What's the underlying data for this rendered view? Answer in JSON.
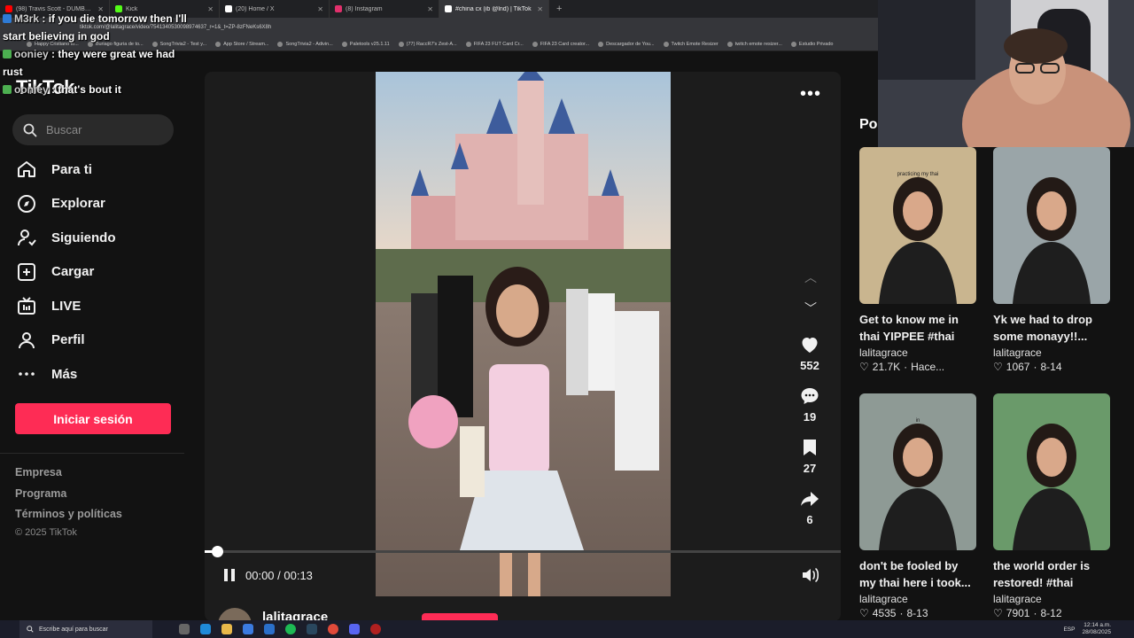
{
  "browser": {
    "tabs": [
      {
        "label": "(98) Travis Scott - DUMBO (Offi",
        "color": "#ff0000",
        "active": false
      },
      {
        "label": "Kick",
        "color": "#53fc18",
        "active": false
      },
      {
        "label": "(20) Home / X",
        "color": "#ffffff",
        "active": false
      },
      {
        "label": "(8) Instagram",
        "color": "#e1306c",
        "active": false
      },
      {
        "label": "#china cx (ib @lnd) | TikTok",
        "color": "#ffffff",
        "active": true
      }
    ],
    "url": "tiktok.com/@lalitagrace/video/7541340530098974637_r=1&_t=ZP-8zFNeKs6X8h",
    "bookmarks": [
      "Happy Cristiano fo...",
      "Buriago figuria de to...",
      "SongTrivia2 - Test y...",
      "App Store / Stream...",
      "SongTrivia2 - Adivin...",
      "Paletools v25.1.11",
      "(77) RaccR7's Zest-A...",
      "FIFA 23 FUT Card Cr...",
      "FIFA 23 Card creator...",
      "Descargador de You...",
      "Twitch Emote Resizer",
      "twitch emote resizer...",
      "Estudio Privado"
    ]
  },
  "chat": [
    {
      "name": "M3rk",
      "message": "if you die tomorrow then I'll start believing in god",
      "color": "#2e7bd6"
    },
    {
      "name": "ooniey",
      "message": "they were great we had rust",
      "color": "#4caf50"
    },
    {
      "name": "ooniey",
      "message": "that's bout it",
      "color": "#4caf50"
    }
  ],
  "sidebar": {
    "logo": "TikTok",
    "search_placeholder": "Buscar",
    "nav": [
      {
        "label": "Para ti",
        "icon": "home-icon"
      },
      {
        "label": "Explorar",
        "icon": "compass-icon"
      },
      {
        "label": "Siguiendo",
        "icon": "following-icon"
      },
      {
        "label": "Cargar",
        "icon": "upload-icon"
      },
      {
        "label": "LIVE",
        "icon": "live-icon"
      },
      {
        "label": "Perfil",
        "icon": "profile-icon"
      },
      {
        "label": "Más",
        "icon": "more-icon"
      }
    ],
    "login_label": "Iniciar sesión",
    "footer_links": [
      "Empresa",
      "Programa",
      "Términos y políticas"
    ],
    "copyright": "© 2025 TikTok"
  },
  "player": {
    "likes": "552",
    "comments": "19",
    "saves": "27",
    "shares": "6",
    "time": "00:00 / 00:13",
    "progress_fraction": 0.02,
    "author": "lalitagrace"
  },
  "related": {
    "title": "Po",
    "cards": [
      {
        "title": "Get to know me in thai YIPPEE #thai",
        "user": "lalitagrace",
        "likes": "21.7K",
        "date": "Hace...",
        "caption": "practicing my thai",
        "bg": "#c9b58f"
      },
      {
        "title": "Yk we had to drop some monayy!!...",
        "user": "lalitagrace",
        "likes": "1067",
        "date": "8-14",
        "caption": "",
        "bg": "#9aa5a8"
      },
      {
        "title": "don't be fooled by my thai here i took...",
        "user": "lalitagrace",
        "likes": "4535",
        "date": "8-13",
        "caption": "in",
        "bg": "#8e9a95"
      },
      {
        "title": "the world order is restored! #thai",
        "user": "lalitagrace",
        "likes": "7901",
        "date": "8-12",
        "caption": "",
        "bg": "#6a9a6a"
      }
    ]
  },
  "taskbar": {
    "search_placeholder": "Escribe aquí para buscar",
    "lang": "ESP",
    "time": "12:14 a.m.",
    "date": "28/08/2025"
  }
}
